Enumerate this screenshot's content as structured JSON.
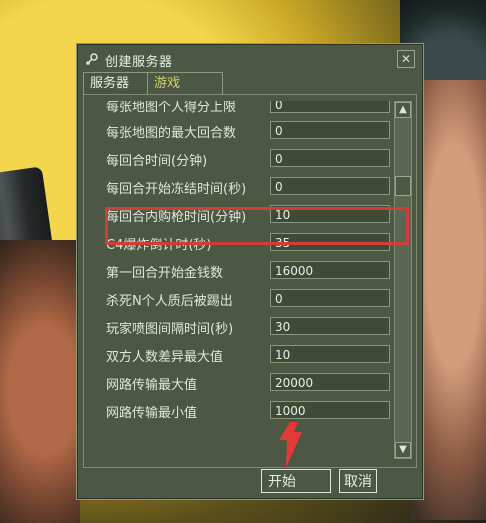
{
  "window": {
    "title": "创建服务器",
    "close": "✕"
  },
  "tabs": [
    {
      "label": "服务器"
    },
    {
      "label": "游戏"
    }
  ],
  "rows": [
    {
      "label": "每张地图个人得分上限",
      "value": "0"
    },
    {
      "label": "每张地图的最大回合数",
      "value": "0"
    },
    {
      "label": "每回合时间(分钟)",
      "value": "0"
    },
    {
      "label": "每回合开始冻结时间(秒)",
      "value": "0"
    },
    {
      "label": "每回合内购枪时间(分钟)",
      "value": "10"
    },
    {
      "label": "C4爆炸倒计时(秒)",
      "value": "35"
    },
    {
      "label": "第一回合开始金钱数",
      "value": "16000"
    },
    {
      "label": "杀死N个人质后被踢出",
      "value": "0"
    },
    {
      "label": "玩家喷图间隔时间(秒)",
      "value": "30"
    },
    {
      "label": "双方人数差异最大值",
      "value": "10"
    },
    {
      "label": "网路传输最大值",
      "value": "20000"
    },
    {
      "label": "网路传输最小值",
      "value": "1000"
    }
  ],
  "buttons": {
    "start": "开始",
    "cancel": "取消"
  },
  "icons": {
    "steam": "steam-icon",
    "scroll_up": "▲",
    "scroll_down": "▼"
  },
  "colors": {
    "highlight": "#d03e3a",
    "tab_active_text": "#d8cf66"
  }
}
